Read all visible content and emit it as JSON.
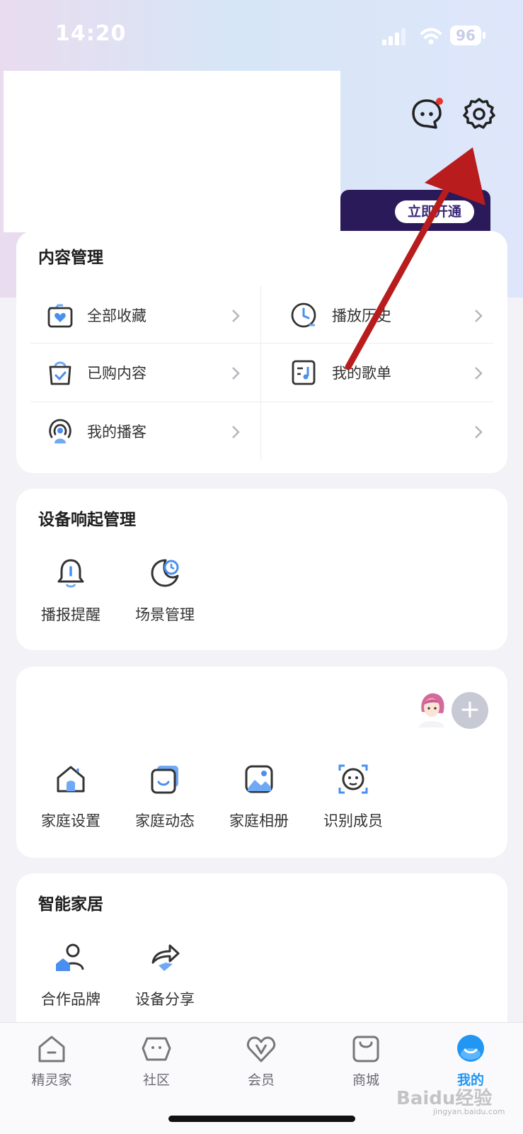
{
  "status_bar": {
    "time": "14:20",
    "battery": "96"
  },
  "header": {
    "vip_button": "立即开通"
  },
  "content_management": {
    "title": "内容管理",
    "items": [
      {
        "label": "全部收藏",
        "icon": "folder-heart-icon"
      },
      {
        "label": "播放历史",
        "icon": "clock-icon"
      },
      {
        "label": "已购内容",
        "icon": "shopping-bag-check-icon"
      },
      {
        "label": "我的歌单",
        "icon": "playlist-icon"
      },
      {
        "label": "我的播客",
        "icon": "podcast-icon"
      },
      {
        "label": "",
        "icon": ""
      }
    ]
  },
  "device_management": {
    "title": "设备响起管理",
    "items": [
      {
        "label": "播报提醒",
        "icon": "bell-icon"
      },
      {
        "label": "场景管理",
        "icon": "moon-clock-icon"
      }
    ]
  },
  "family": {
    "add_symbol": "+",
    "items": [
      {
        "label": "家庭设置",
        "icon": "house-icon"
      },
      {
        "label": "家庭动态",
        "icon": "smile-card-icon"
      },
      {
        "label": "家庭相册",
        "icon": "photo-icon"
      },
      {
        "label": "识别成员",
        "icon": "face-scan-icon"
      }
    ]
  },
  "smart_home": {
    "title": "智能家居",
    "items": [
      {
        "label": "合作品牌",
        "icon": "person-brand-icon"
      },
      {
        "label": "设备分享",
        "icon": "share-arrow-icon"
      }
    ]
  },
  "tabbar": {
    "tabs": [
      {
        "label": "精灵家",
        "icon": "home-tab-icon"
      },
      {
        "label": "社区",
        "icon": "community-tab-icon"
      },
      {
        "label": "会员",
        "icon": "vip-tab-icon"
      },
      {
        "label": "商城",
        "icon": "shop-tab-icon"
      },
      {
        "label": "我的",
        "icon": "me-tab-icon"
      }
    ],
    "active_index": 4,
    "active_color": "#2196f3"
  },
  "watermark": {
    "main": "Baidu经验",
    "sub": "jingyan.baidu.com"
  },
  "colors": {
    "accent": "#2196f3",
    "annotation_arrow": "#b81c1c",
    "vip_strip": "#2b1a5a"
  }
}
